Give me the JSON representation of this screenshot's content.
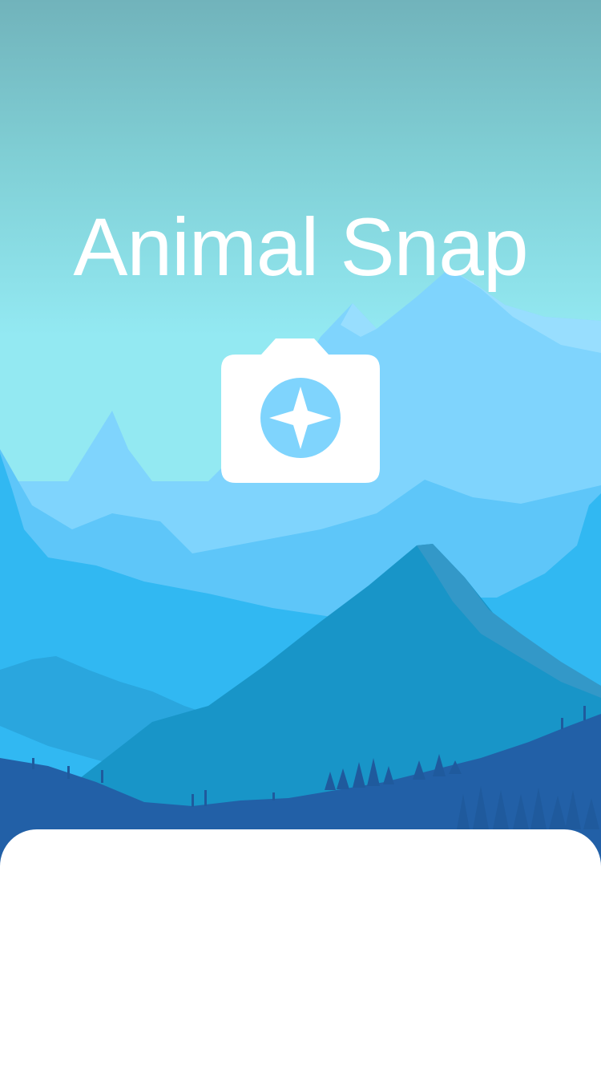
{
  "app": {
    "title": "Animal Snap"
  },
  "logo": {
    "icon": "camera-compass-icon"
  },
  "background": {
    "illustration": "mountain-landscape",
    "sky_top_color": "#71b3bb",
    "sky_bottom_color": "#93e9f2",
    "mountain_colors": [
      "#7fd4fd",
      "#5ec6f9",
      "#31b8f2",
      "#1895c8",
      "#2260a7"
    ]
  },
  "bottom_sheet": {
    "color": "#ffffff"
  }
}
